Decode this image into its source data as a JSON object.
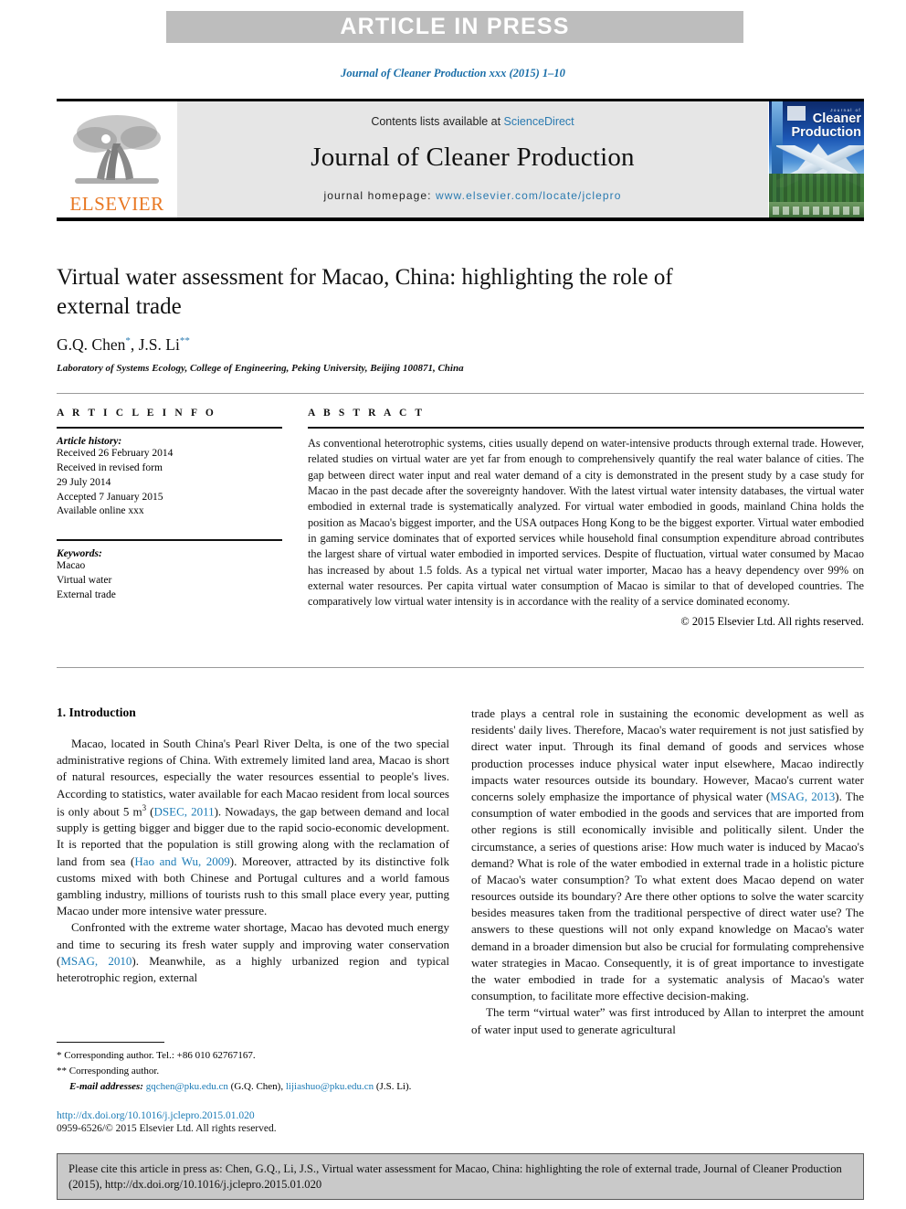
{
  "banner": {
    "label": "ARTICLE IN PRESS"
  },
  "running_head": "Journal of Cleaner Production xxx (2015) 1–10",
  "masthead": {
    "contents_prefix": "Contents lists available at ",
    "sciencedirect": "ScienceDirect",
    "journal_title": "Journal of Cleaner Production",
    "homepage_prefix": "journal homepage: ",
    "homepage_url": "www.elsevier.com/locate/jclepro",
    "publisher": "ELSEVIER",
    "cover": {
      "kicker": "Journal of",
      "line1": "Cleaner",
      "line2": "Production"
    }
  },
  "article": {
    "title": "Virtual water assessment for Macao, China: highlighting the role of external trade",
    "authors": "G.Q. Chen, J.S. Li",
    "author_1": "G.Q. Chen",
    "author_1_mark": "*",
    "author_2": "J.S. Li",
    "author_2_mark": "**",
    "affiliation": "Laboratory of Systems Ecology, College of Engineering, Peking University, Beijing 100871, China"
  },
  "info": {
    "heading": "A R T I C L E  I N F O",
    "history_label": "Article history:",
    "history": [
      "Received 26 February 2014",
      "Received in revised form",
      "29 July 2014",
      "Accepted 7 January 2015",
      "Available online xxx"
    ],
    "keywords_label": "Keywords:",
    "keywords": [
      "Macao",
      "Virtual water",
      "External trade"
    ]
  },
  "abstract": {
    "heading": "A B S T R A C T",
    "text": "As conventional heterotrophic systems, cities usually depend on water-intensive products through external trade. However, related studies on virtual water are yet far from enough to comprehensively quantify the real water balance of cities. The gap between direct water input and real water demand of a city is demonstrated in the present study by a case study for Macao in the past decade after the sovereignty handover. With the latest virtual water intensity databases, the virtual water embodied in external trade is systematically analyzed. For virtual water embodied in goods, mainland China holds the position as Macao's biggest importer, and the USA outpaces Hong Kong to be the biggest exporter. Virtual water embodied in gaming service dominates that of exported services while household final consumption expenditure abroad contributes the largest share of virtual water embodied in imported services. Despite of fluctuation, virtual water consumed by Macao has increased by about 1.5 folds. As a typical net virtual water importer, Macao has a heavy dependency over 99% on external water resources. Per capita virtual water consumption of Macao is similar to that of developed countries. The comparatively low virtual water intensity is in accordance with the reality of a service dominated economy.",
    "copyright": "© 2015 Elsevier Ltd. All rights reserved."
  },
  "body": {
    "section_number_title": "1. Introduction",
    "left_p1_a": "Macao, located in South China's Pearl River Delta, is one of the two special administrative regions of China. With extremely limited land area, Macao is short of natural resources, especially the water resources essential to people's lives. According to statistics, water available for each Macao resident from local sources is only about 5 m",
    "left_p1_sup": "3",
    "left_p1_b": " (",
    "left_p1_cite1": "DSEC, 2011",
    "left_p1_c": "). Nowadays, the gap between demand and local supply is getting bigger and bigger due to the rapid socio-economic development. It is reported that the population is still growing along with the reclamation of land from sea (",
    "left_p1_cite2": "Hao and Wu, 2009",
    "left_p1_d": "). Moreover, attracted by its distinctive folk customs mixed with both Chinese and Portugal cultures and a world famous gambling industry, millions of tourists rush to this small place every year, putting Macao under more intensive water pressure.",
    "left_p2_a": "Confronted with the extreme water shortage, Macao has devoted much energy and time to securing its fresh water supply and improving water conservation (",
    "left_p2_cite": "MSAG, 2010",
    "left_p2_b": "). Meanwhile, as a highly urbanized region and typical heterotrophic region, external",
    "right_p1_a": "trade plays a central role in sustaining the economic development as well as residents' daily lives. Therefore, Macao's water requirement is not just satisfied by direct water input. Through its final demand of goods and services whose production processes induce physical water input elsewhere, Macao indirectly impacts water resources outside its boundary. However, Macao's current water concerns solely emphasize the importance of physical water (",
    "right_p1_cite": "MSAG, 2013",
    "right_p1_b": "). The consumption of water embodied in the goods and services that are imported from other regions is still economically invisible and politically silent. Under the circumstance, a series of questions arise: How much water is induced by Macao's demand? What is role of the water embodied in external trade in a holistic picture of Macao's water consumption? To what extent does Macao depend on water resources outside its boundary? Are there other options to solve the water scarcity besides measures taken from the traditional perspective of direct water use? The answers to these questions will not only expand knowledge on Macao's water demand in a broader dimension but also be crucial for formulating comprehensive water strategies in Macao. Consequently, it is of great importance to investigate the water embodied in trade for a systematic analysis of Macao's water consumption, to facilitate more effective decision-making.",
    "right_p2": "The term “virtual water” was first introduced by Allan to interpret the amount of water input used to generate agricultural"
  },
  "footnotes": {
    "fn1_mark": "*",
    "fn1": "Corresponding author. Tel.: +86 010 62767167.",
    "fn2_mark": "**",
    "fn2": "Corresponding author.",
    "emails_label": "E-mail addresses:",
    "email_1": "gqchen@pku.edu.cn",
    "email_1_owner": "(G.Q. Chen),",
    "email_2": "lijiashuo@pku.edu.cn",
    "email_2_owner": "(J.S. Li)."
  },
  "doi_block": {
    "doi_url": "http://dx.doi.org/10.1016/j.jclepro.2015.01.020",
    "issn_line": "0959-6526/© 2015 Elsevier Ltd. All rights reserved."
  },
  "cite_box": {
    "text": "Please cite this article in press as: Chen, G.Q., Li, J.S., Virtual water assessment for Macao, China: highlighting the role of external trade, Journal of Cleaner Production (2015), http://dx.doi.org/10.1016/j.jclepro.2015.01.020"
  },
  "colors": {
    "link": "#1a7ab5",
    "banner_bg": "#bdbdbd",
    "masthead_bg": "#e6e6e6",
    "elsevier_orange": "#e87722",
    "cite_box_bg": "#c9c9c9"
  }
}
